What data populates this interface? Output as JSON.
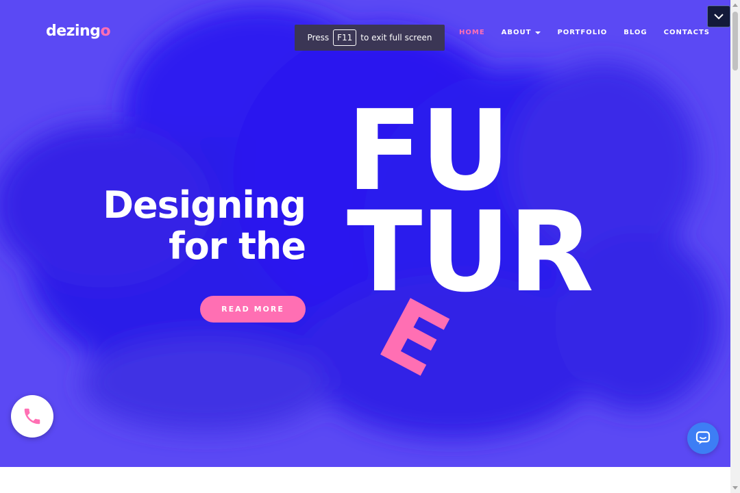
{
  "brand": {
    "logo_main": "dezing",
    "logo_accent": "o"
  },
  "nav": {
    "items": [
      {
        "label": "HOME",
        "active": true
      },
      {
        "label": "ABOUT",
        "has_dropdown": true
      },
      {
        "label": "PORTFOLIO"
      },
      {
        "label": "BLOG"
      },
      {
        "label": "CONTACTS"
      }
    ]
  },
  "fullscreen_notice": {
    "before": "Press",
    "key": "F11",
    "after": "to exit full screen"
  },
  "hero": {
    "headline_line1": "Designing",
    "headline_line2": "for the",
    "big_word_line1": "FU",
    "big_word_line2": "TUR",
    "big_word_tilted": "E",
    "cta_label": "READ MORE"
  },
  "icons": {
    "collapse": "chevron-down-icon",
    "phone": "phone-icon",
    "chat": "chat-icon"
  },
  "colors": {
    "hero_bg": "#5b49f4",
    "accent_pink": "#ff6fb3",
    "chat_blue": "#3d7ef5"
  }
}
